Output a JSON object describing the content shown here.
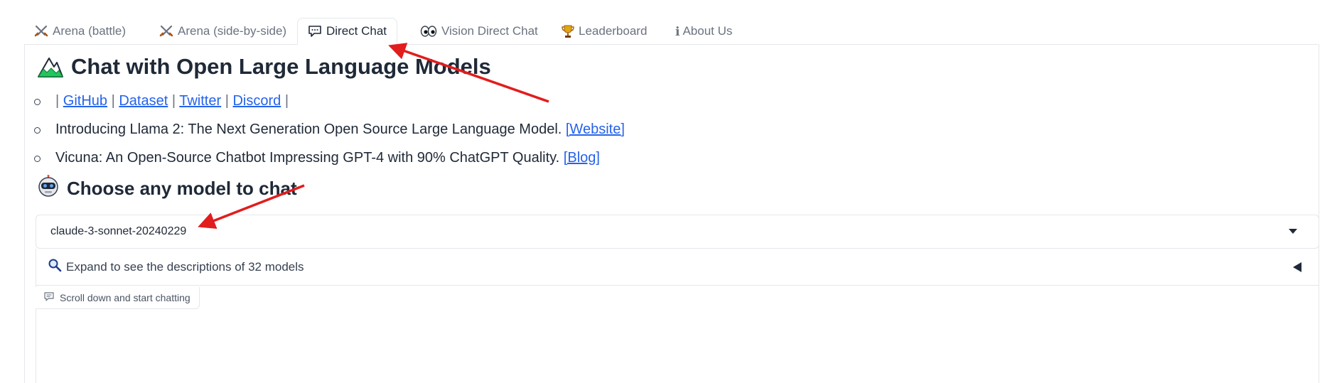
{
  "tabs": [
    {
      "label": "Arena (battle)",
      "icon": "crossed-swords-icon"
    },
    {
      "label": "Arena (side-by-side)",
      "icon": "crossed-swords-icon"
    },
    {
      "label": "Direct Chat",
      "icon": "speech-bubble-icon",
      "active": true
    },
    {
      "label": "Vision Direct Chat",
      "icon": "eyes-icon"
    },
    {
      "label": "Leaderboard",
      "icon": "trophy-icon"
    },
    {
      "label": "About Us",
      "icon": "info-icon",
      "icon_text": "ℹ"
    }
  ],
  "header": {
    "title": "Chat with Open Large Language Models",
    "title_icon": "mountain-icon"
  },
  "links": {
    "sep": "|",
    "github": "GitHub",
    "dataset": "Dataset",
    "twitter": "Twitter",
    "discord": "Discord"
  },
  "news": [
    {
      "text": "Introducing Llama 2: The Next Generation Open Source Large Language Model. ",
      "link": "[Website]"
    },
    {
      "text": "Vicuna: An Open-Source Chatbot Impressing GPT-4 with 90% ChatGPT Quality. ",
      "link": "[Blog]"
    }
  ],
  "model_section": {
    "title": "Choose any model to chat",
    "title_icon": "robot-icon",
    "selected_model": "claude-3-sonnet-20240229",
    "expand_label": "Expand to see the descriptions of 32 models",
    "expand_icon": "magnifier-icon"
  },
  "chat": {
    "label": "Scroll down and start chatting",
    "label_icon": "chat-icon"
  },
  "colors": {
    "link": "#2563eb",
    "annotation_arrow": "#e11d1d",
    "border": "#e5e7eb"
  }
}
